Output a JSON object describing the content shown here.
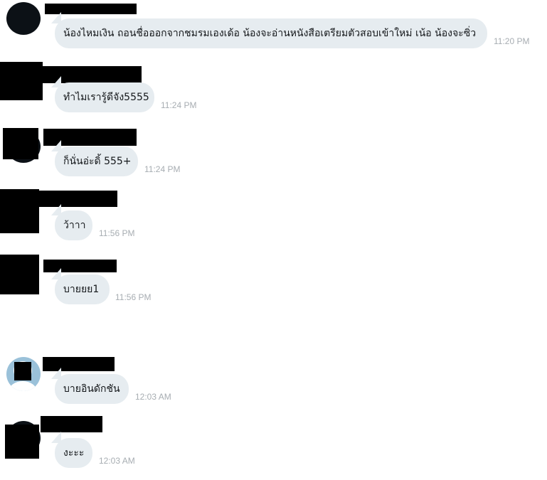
{
  "messages": [
    {
      "text": "น้องไหมเงิน ถอนชื่อออกจากชมรมเองเด้อ น้องจะอ่านหนังสือเตรียมตัวสอบเข้าใหม่ เน้อ น้องจะซิ่ว",
      "time": "11:20 PM"
    },
    {
      "text": "ทำไมเรารู้ดีจัง5555",
      "time": "11:24 PM"
    },
    {
      "text": "ก็นั่นอ่ะดิ้ 555+",
      "time": "11:24 PM"
    },
    {
      "text": "ว้าาา",
      "time": "11:56 PM"
    },
    {
      "text": "บายยย1",
      "time": "11:56 PM"
    },
    {
      "text": "บายอินดักชัน",
      "time": "12:03 AM"
    },
    {
      "text": "งะะะ",
      "time": "12:03 AM"
    }
  ],
  "colors": {
    "bubble": "#e6ecf0",
    "text": "#14171a",
    "timestamp": "#a7adb2",
    "redaction": "#000000",
    "avatar_default": "#9ac1d9"
  },
  "icons": {
    "avatar": "user-avatar-icon",
    "default_avatar": "default-profile-icon"
  }
}
